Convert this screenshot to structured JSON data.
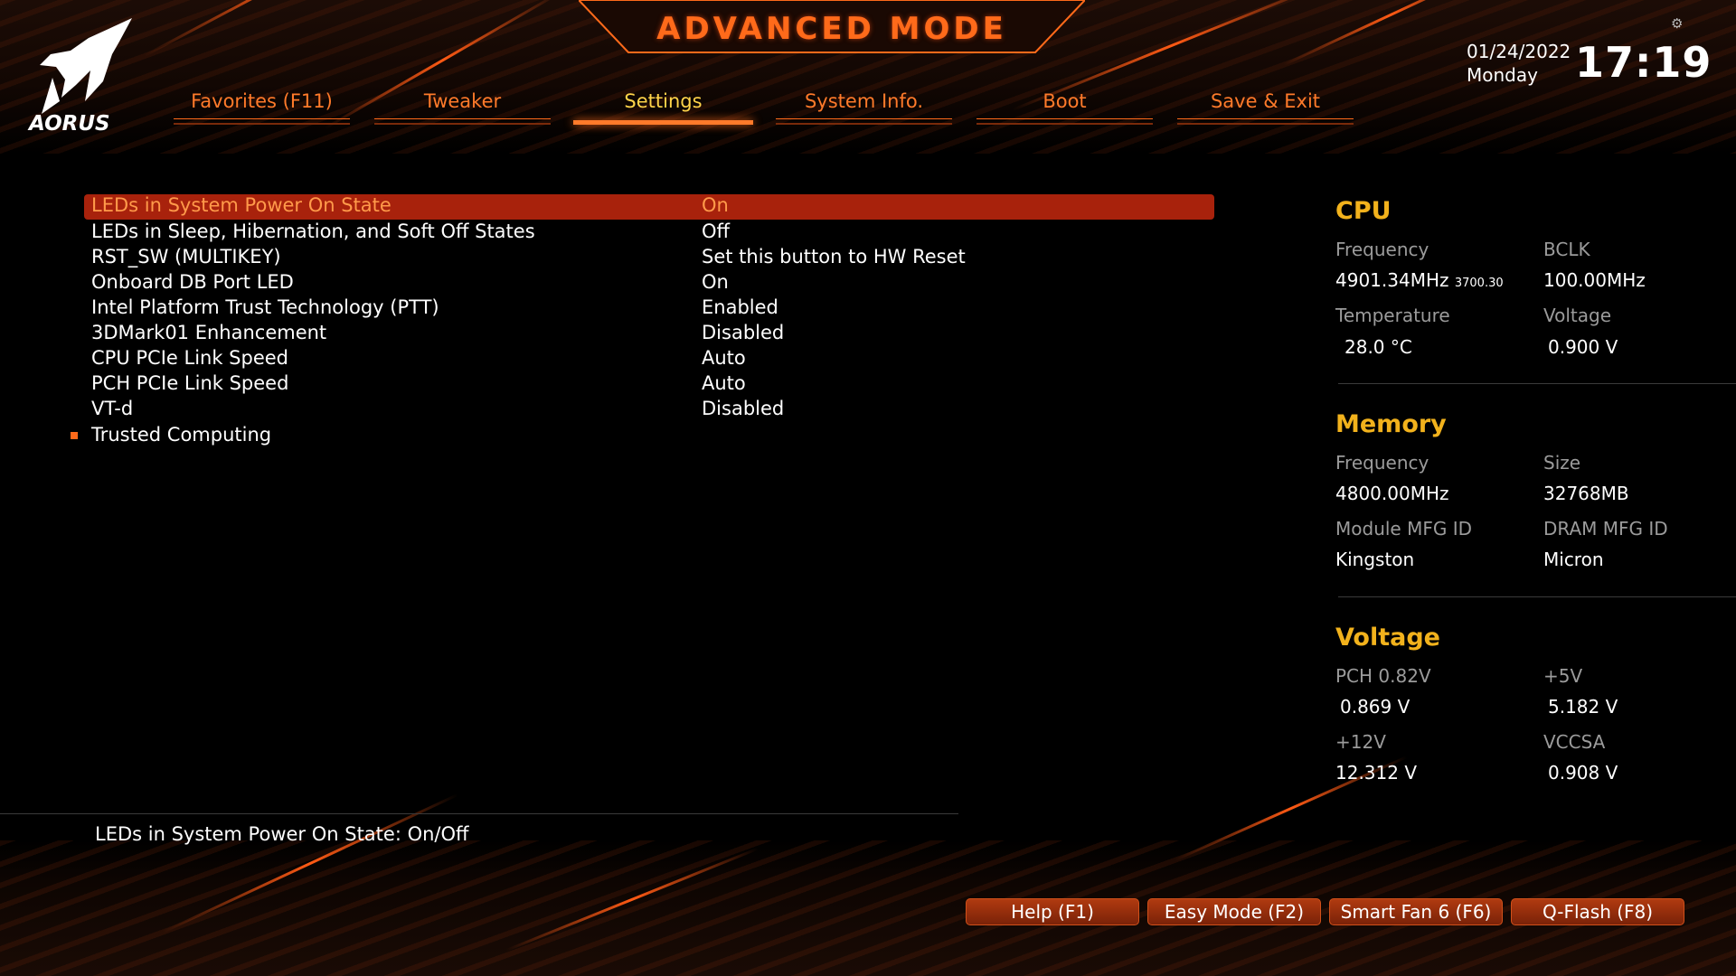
{
  "header": {
    "title": "ADVANCED MODE",
    "logo_text": "AORUS",
    "date": "01/24/2022",
    "weekday": "Monday",
    "time": "17:19"
  },
  "tabs": [
    {
      "label": "Favorites (F11)",
      "active": false
    },
    {
      "label": "Tweaker",
      "active": false
    },
    {
      "label": "Settings",
      "active": true
    },
    {
      "label": "System Info.",
      "active": false
    },
    {
      "label": "Boot",
      "active": false
    },
    {
      "label": "Save & Exit",
      "active": false
    }
  ],
  "settings": [
    {
      "label": "LEDs in System Power On State",
      "value": "On",
      "selected": true
    },
    {
      "label": "LEDs in Sleep, Hibernation, and Soft Off States",
      "value": "Off"
    },
    {
      "label": "RST_SW (MULTIKEY)",
      "value": "Set this button to HW Reset"
    },
    {
      "label": "Onboard DB Port LED",
      "value": "On"
    },
    {
      "label": "Intel Platform Trust Technology (PTT)",
      "value": "Enabled"
    },
    {
      "label": "3DMark01 Enhancement",
      "value": "Disabled"
    },
    {
      "label": "CPU PCIe Link Speed",
      "value": "Auto"
    },
    {
      "label": "PCH PCIe Link Speed",
      "value": "Auto"
    },
    {
      "label": "VT-d",
      "value": "Disabled"
    },
    {
      "label": "Trusted Computing",
      "value": ""
    }
  ],
  "help_text": "LEDs in System Power On State: On/Off",
  "cpu": {
    "title": "CPU",
    "frequency_label": "Frequency",
    "frequency": "4901.34MHz",
    "frequency_sub": "3700.30",
    "bclk_label": "BCLK",
    "bclk": "100.00MHz",
    "temperature_label": "Temperature",
    "temperature": "28.0 °C",
    "voltage_label": "Voltage",
    "voltage": "0.900 V"
  },
  "memory": {
    "title": "Memory",
    "frequency_label": "Frequency",
    "frequency": "4800.00MHz",
    "size_label": "Size",
    "size": "32768MB",
    "module_label": "Module MFG ID",
    "module": "Kingston",
    "dram_label": "DRAM MFG ID",
    "dram": "Micron"
  },
  "voltage": {
    "title": "Voltage",
    "pch_label": "PCH 0.82V",
    "pch": "0.869 V",
    "p5v_label": "+5V",
    "p5v": "5.182 V",
    "p12v_label": "+12V",
    "p12v": "12.312 V",
    "vccsa_label": "VCCSA",
    "vccsa": "0.908 V"
  },
  "buttons": {
    "help": "Help (F1)",
    "easy_mode": "Easy Mode (F2)",
    "smart_fan": "Smart Fan 6 (F6)",
    "qflash": "Q-Flash (F8)"
  },
  "colors": {
    "accent": "#ff6a1a",
    "active_tab": "#ffd44a",
    "panel_title": "#f2b21c",
    "highlight": "#a8220c"
  }
}
